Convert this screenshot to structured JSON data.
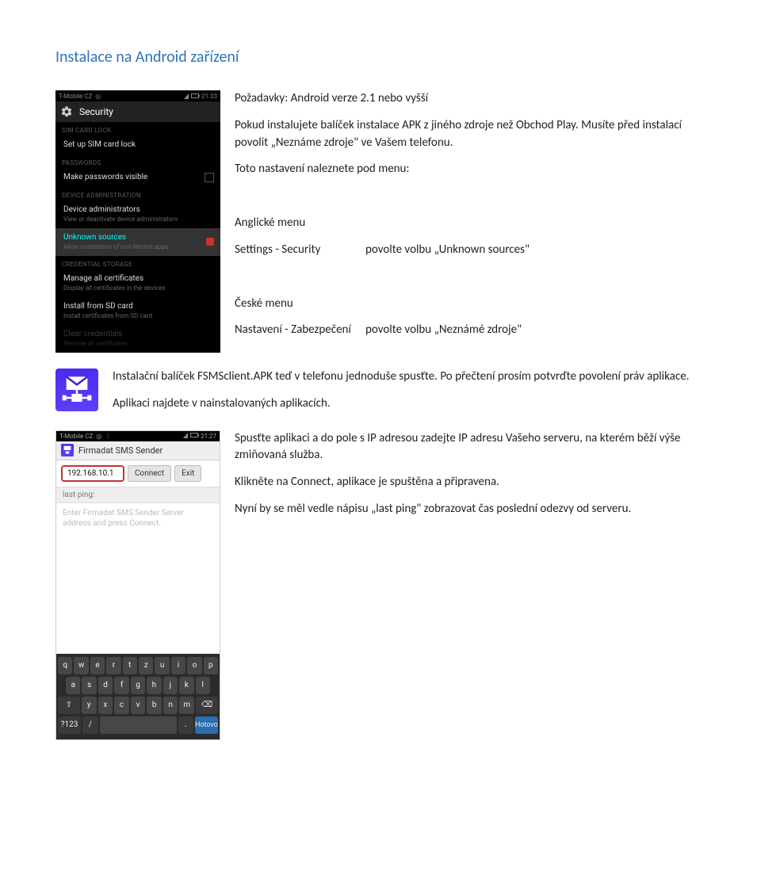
{
  "heading": "Instalace na Android zařízení",
  "intro": {
    "p1": "Požadavky: Android verze 2.1 nebo vyšší",
    "p2": "Pokud instalujete balíček instalace APK z jiného zdroje než Obchod Play. Musíte před instalací povolit „Neznáme zdroje\" ve Vašem telefonu.",
    "p3": "Toto nastavení naleznete pod menu:"
  },
  "menu_en": {
    "title": "Anglické menu",
    "path": "Settings - Security",
    "action": "povolte volbu „Unknown sources\""
  },
  "menu_cz": {
    "title": "České menu",
    "path": "Nastavení - Zabezpečení",
    "action": "povolte volbu „Neznámé zdroje\""
  },
  "apk": {
    "p1": "Instalační balíček FSMSclient.APK teď v telefonu jednoduše spusťte. Po přečtení prosím potvrďte povolení práv aplikace.",
    "p2": "Aplikaci najdete v nainstalovaných aplikacích."
  },
  "run": {
    "p1": "Spusťte aplikaci a do pole s IP adresou zadejte IP adresu Vašeho serveru, na kterém běží výše zmiňovaná služba.",
    "p2": "Klikněte na Connect, aplikace je spuštěna a připravena.",
    "p3": "Nyní by se měl vedle nápisu „last ping\" zobrazovat čas poslední odezvy od serveru."
  },
  "shot1": {
    "carrier": "T-Mobile CZ",
    "time": "21:33",
    "title": "Security",
    "sec1": "SIM CARD LOCK",
    "i1": "Set up SIM card lock",
    "sec2": "PASSWORDS",
    "i2": "Make passwords visible",
    "sec3": "DEVICE ADMINISTRATION",
    "i3t": "Device administrators",
    "i3s": "View or deactivate device administrators",
    "i4t": "Unknown sources",
    "i4s": "Allow installation of non-Market apps",
    "sec4": "CREDENTIAL STORAGE",
    "i5t": "Manage all certificates",
    "i5s": "Display all certificates in the devices",
    "i6t": "Install from SD card",
    "i6s": "Install certificates from SD card",
    "i7t": "Clear credentials",
    "i7s": "Remove all certificates"
  },
  "shot3": {
    "carrier": "T-Mobile CZ",
    "time": "21:27",
    "title": "Firmadat SMS Sender",
    "ip": "192.168.10.1",
    "btn_connect": "Connect",
    "btn_exit": "Exit",
    "lastping": "last ping:",
    "hint": "Enter Firmadat SMS Sender Server address and press Connect.",
    "kb": {
      "r1": [
        "q",
        "w",
        "e",
        "r",
        "t",
        "z",
        "u",
        "i",
        "o",
        "p"
      ],
      "r2": [
        "a",
        "s",
        "d",
        "f",
        "g",
        "h",
        "j",
        "k",
        "l"
      ],
      "r3_shift": "⇧",
      "r3": [
        "y",
        "x",
        "c",
        "v",
        "b",
        "n",
        "m"
      ],
      "r3_del": "⌫",
      "r4_num": "?123",
      "r4_slash": "/",
      "r4_dot": ".",
      "r4_done": "Hotovo"
    }
  }
}
